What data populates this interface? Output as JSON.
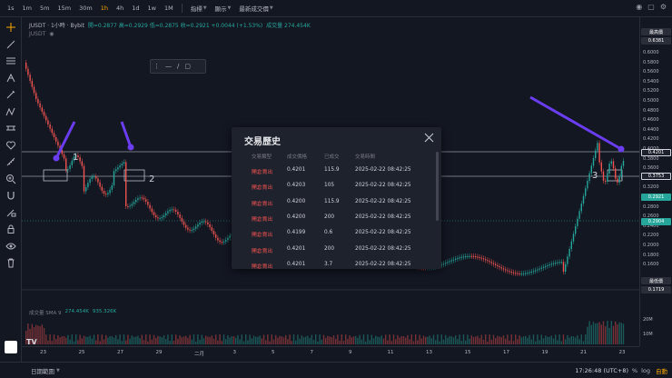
{
  "toolbar": {
    "timeframes": [
      {
        "label": "1s",
        "active": false
      },
      {
        "label": "1m",
        "active": false
      },
      {
        "label": "5m",
        "active": false
      },
      {
        "label": "15m",
        "active": false
      },
      {
        "label": "30m",
        "active": false
      },
      {
        "label": "1h",
        "active": true
      },
      {
        "label": "4h",
        "active": false
      },
      {
        "label": "1d",
        "active": false
      },
      {
        "label": "1w",
        "active": false
      },
      {
        "label": "1M",
        "active": false
      }
    ],
    "menus": [
      "指標",
      "顯示",
      "最新成交價"
    ]
  },
  "legend": {
    "symbol": "JUSDT · 1小時 · Bybit",
    "ohlc": "開=0.2877 高=0.2929 低=0.2875 收=0.2921 +0.0044 (+1.53%)",
    "volume": "成交量 274.454K",
    "second": "JUSDT"
  },
  "price_axis": {
    "top_tag": "最高價",
    "top_value": "0.6381",
    "labels": [
      "0.6000",
      "0.5800",
      "0.5600",
      "0.5400",
      "0.5200",
      "0.5000",
      "0.4800",
      "0.4600",
      "0.4400",
      "0.4200",
      "0.4000",
      "0.3800",
      "0.3600",
      "0.3400",
      "0.3200",
      "0.3000",
      "0.2800",
      "0.2600",
      "0.2400",
      "0.2200",
      "0.2000",
      "0.1800",
      "0.1600"
    ],
    "tags": [
      {
        "value": "0.4201",
        "color": "#1e222d",
        "border": "#d1d4dc"
      },
      {
        "value": "0.3753",
        "color": "#1e222d",
        "border": "#d1d4dc"
      },
      {
        "value": "0.2921",
        "color": "#26a69a",
        "border": "#26a69a"
      },
      {
        "value": "0.2904",
        "color": "#26a69a",
        "border": "#26a69a"
      }
    ],
    "low_tag": "最低價",
    "low_value": "0.1719",
    "vol_labels": [
      "20M",
      "10M"
    ]
  },
  "time_axis": [
    "23",
    "25",
    "27",
    "29",
    "二月",
    "3",
    "5",
    "7",
    "9",
    "11",
    "13",
    "15",
    "17",
    "19",
    "21",
    "23"
  ],
  "volume_legend": {
    "label": "成交量 SMA 9",
    "v1": "274.454K",
    "v2": "935.326K"
  },
  "modal": {
    "title": "交易歷史",
    "headers": [
      "交易類型",
      "成交價格",
      "已成交",
      "交易時間"
    ],
    "rows": [
      {
        "side": "開倉賣出",
        "price": "0.4201",
        "filled": "115.9",
        "time": "2025-02-22 08:42:25"
      },
      {
        "side": "開倉賣出",
        "price": "0.4203",
        "filled": "105",
        "time": "2025-02-22 08:42:25"
      },
      {
        "side": "開倉賣出",
        "price": "0.4200",
        "filled": "115.9",
        "time": "2025-02-22 08:42:25"
      },
      {
        "side": "開倉賣出",
        "price": "0.4200",
        "filled": "200",
        "time": "2025-02-22 08:42:25"
      },
      {
        "side": "開倉賣出",
        "price": "0.4199",
        "filled": "0.6",
        "time": "2025-02-22 08:42:25"
      },
      {
        "side": "開倉賣出",
        "price": "0.4201",
        "filled": "200",
        "time": "2025-02-22 08:42:25"
      },
      {
        "side": "開倉賣出",
        "price": "0.4201",
        "filled": "3.7",
        "time": "2025-02-22 08:42:25"
      }
    ]
  },
  "bottombar": {
    "range": "日期範圍",
    "clock": "17:26:48 (UTC+8)",
    "pct": "%",
    "log": "log",
    "auto": "自動"
  },
  "annotations": [
    "1",
    "2",
    "3"
  ],
  "colors": {
    "bg": "#131722",
    "up": "#26a69a",
    "down": "#ef5350",
    "accent": "#f7a600",
    "arrow": "#6a3df0"
  }
}
